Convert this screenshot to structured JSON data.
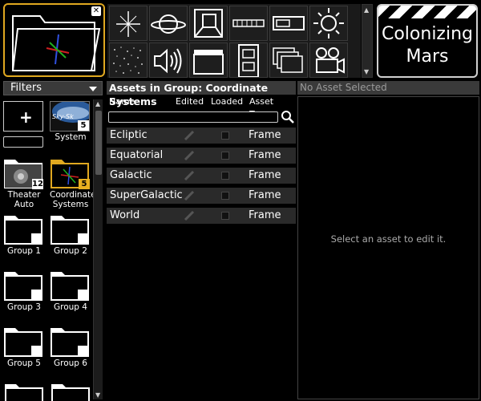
{
  "project": {
    "title_line1": "Colonizing",
    "title_line2": "Mars"
  },
  "toolbar": {
    "icons": [
      "star-icon",
      "planet-icon",
      "frustum-icon",
      "ruler-icon",
      "projector-icon",
      "sun-icon",
      "starfield-icon",
      "speaker-icon",
      "clapperboard-icon",
      "film-strip-icon",
      "layers-icon",
      "movie-camera-icon"
    ]
  },
  "filters": {
    "label": "Filters"
  },
  "groups": [
    {
      "label": "",
      "kind": "add",
      "name": "add-group"
    },
    {
      "label": "System",
      "badge": "5",
      "kind": "system"
    },
    {
      "label": "Theater\nAuto",
      "badge": "12",
      "kind": "theater"
    },
    {
      "label": "Coordinate\nSystems",
      "badge": "5",
      "kind": "coord",
      "selected": true
    },
    {
      "label": "Group 1"
    },
    {
      "label": "Group 2"
    },
    {
      "label": "Group 3"
    },
    {
      "label": "Group 4"
    },
    {
      "label": "Group 5"
    },
    {
      "label": "Group 6"
    }
  ],
  "system_thumb_text": "Sky-Sk",
  "assets": {
    "header": "Assets in Group: Coordinate Systems",
    "columns": {
      "name": "Name",
      "edited": "Edited",
      "loaded": "Loaded",
      "type": "Asset Type"
    },
    "rows": [
      {
        "name": "Ecliptic",
        "type": "Frame"
      },
      {
        "name": "Equatorial",
        "type": "Frame"
      },
      {
        "name": "Galactic",
        "type": "Frame"
      },
      {
        "name": "SuperGalactic",
        "type": "Frame"
      },
      {
        "name": "World",
        "type": "Frame"
      }
    ]
  },
  "editor": {
    "header": "No Asset Selected",
    "message": "Select an asset to edit it."
  },
  "colors": {
    "accent": "#e0a820",
    "panel": "#3a3a3a",
    "row": "#2a2a2a"
  }
}
